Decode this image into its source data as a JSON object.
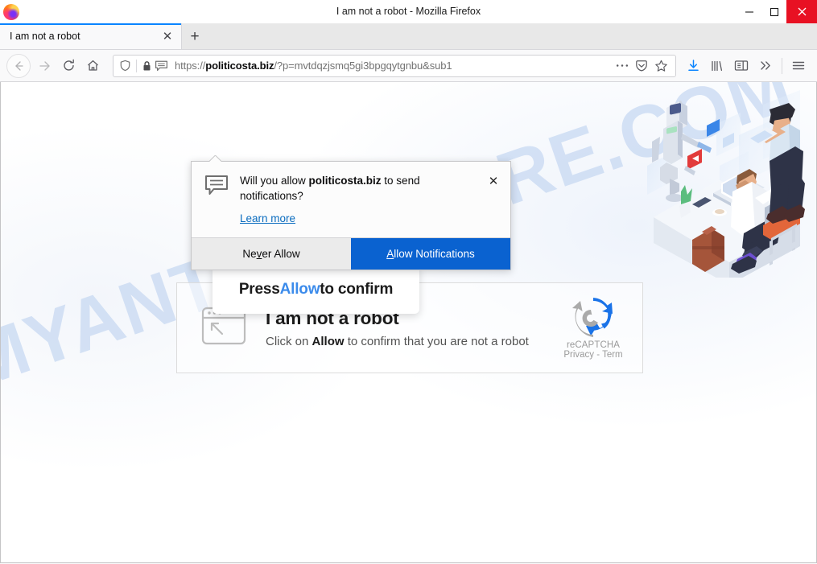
{
  "window": {
    "title": "I am not a robot - Mozilla Firefox",
    "logo_icon": "firefox-logo",
    "minimize_icon": "minimize-icon",
    "maximize_icon": "maximize-icon",
    "close_icon": "close-icon",
    "close_color": "#e81123"
  },
  "tabs": {
    "active": {
      "title": "I am not a robot",
      "close_icon": "tab-close-icon"
    },
    "new_tab_icon": "plus-icon"
  },
  "toolbar": {
    "back_icon": "back-arrow-icon",
    "forward_icon": "forward-arrow-icon",
    "reload_icon": "reload-icon",
    "home_icon": "home-icon",
    "shield_icon": "shield-icon",
    "lock_icon": "padlock-icon",
    "notification_icon": "speech-bubble-icon",
    "page_actions_icon": "ellipsis-icon",
    "pocket_icon": "pocket-icon",
    "bookmark_icon": "star-icon",
    "downloads_icon": "download-arrow-icon",
    "library_icon": "library-icon",
    "sidebar_icon": "sidebar-icon",
    "overflow_icon": "double-chevron-icon",
    "menu_icon": "hamburger-menu-icon",
    "accent_color": "#0a84ff"
  },
  "url": {
    "scheme": "https://",
    "host": "politicosta.biz",
    "path": "/?p=mvtdqzjsmq5gi3bpgqytgnbu&sub1",
    "full": "https://politicosta.biz/?p=mvtdqzjsmq5gi3bpgqytgnbu&sub1"
  },
  "doorhanger": {
    "icon": "notification-bubble-icon",
    "message_prefix": "Will you allow ",
    "message_host": "politicosta.biz",
    "message_suffix": " to send notifications?",
    "learn_more": "Learn more",
    "close_icon": "close-icon",
    "never_allow": {
      "prefix": "Ne",
      "accesskey": "v",
      "suffix": "er Allow"
    },
    "allow": {
      "accesskey": "A",
      "suffix": "llow Notifications"
    },
    "primary_color": "#0a62d0"
  },
  "press_allow": {
    "before": "Press ",
    "highlight": "Allow",
    "after": " to confirm",
    "highlight_color": "#3b8beb"
  },
  "captcha": {
    "icon": "browser-cursor-icon",
    "title": "I am not a robot",
    "subtitle_before": "Click on ",
    "subtitle_bold": "Allow",
    "subtitle_after": " to confirm that you are not a robot",
    "recaptcha": {
      "logo_icon": "recaptcha-logo-icon",
      "name": "reCAPTCHA",
      "links": "Privacy - Term"
    }
  },
  "page": {
    "watermark": "MYANTISPYWARE.COM",
    "watermark_color": "#c6d8f2",
    "illustration": "office-robot-illustration"
  }
}
